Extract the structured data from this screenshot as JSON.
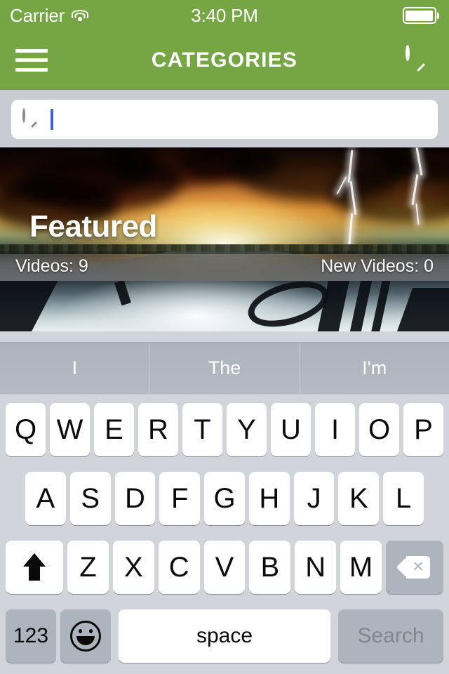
{
  "status_bar": {
    "carrier": "Carrier",
    "wifi_icon": "wifi-icon",
    "time": "3:40 PM",
    "battery_icon": "battery-full-icon"
  },
  "nav_bar": {
    "menu_icon": "hamburger-menu-icon",
    "title": "CATEGORIES",
    "search_icon": "search-icon",
    "background_color": "#76a644"
  },
  "search": {
    "icon": "search-icon",
    "value": "",
    "placeholder": "",
    "caret_color": "#4161d8"
  },
  "cards": [
    {
      "title": "Featured",
      "videos_label": "Videos: 9",
      "new_videos_label": "New Videos: 0",
      "artwork": "stormy-sunset-road-lightning"
    },
    {
      "title": "",
      "videos_label": "",
      "new_videos_label": "",
      "artwork": "basketball-hoop-silhouette"
    }
  ],
  "keyboard": {
    "predictions": [
      "I",
      "The",
      "I'm"
    ],
    "row1": [
      "Q",
      "W",
      "E",
      "R",
      "T",
      "Y",
      "U",
      "I",
      "O",
      "P"
    ],
    "row2": [
      "A",
      "S",
      "D",
      "F",
      "G",
      "H",
      "J",
      "K",
      "L"
    ],
    "row3": [
      "Z",
      "X",
      "C",
      "V",
      "B",
      "N",
      "M"
    ],
    "shift_icon": "shift-arrow-icon",
    "backspace_icon": "backspace-delete-icon",
    "numbers_key": "123",
    "emoji_icon": "emoji-smiley-icon",
    "space_key": "space",
    "return_key": "Search",
    "background_color": "#d1d4da",
    "prediction_bar_color": "#aeb4bd"
  }
}
